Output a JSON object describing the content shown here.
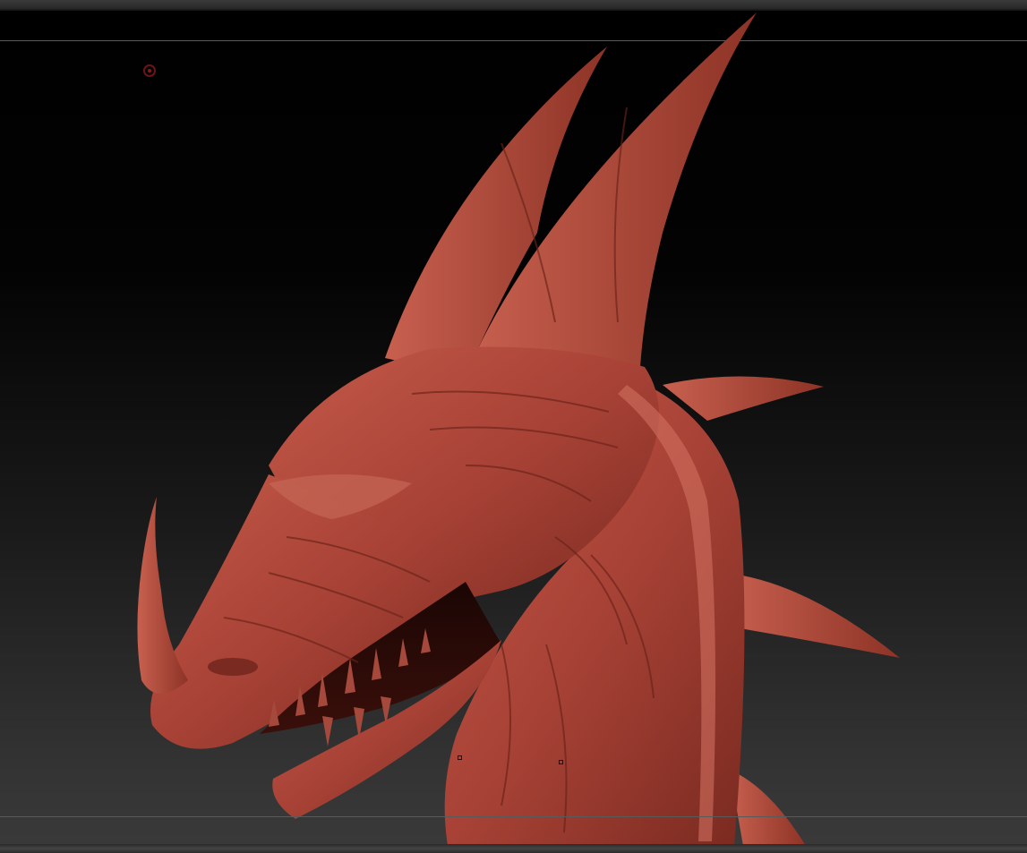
{
  "viewport": {
    "background_top": "#000000",
    "background_bottom": "#3a3a3a",
    "frame_line_color": "#5a5a5a"
  },
  "model": {
    "subject": "dragon-head-sculpt",
    "material_color": "#b0473a",
    "highlight_color": "#cf6a5a",
    "shadow_color": "#5a1a12"
  },
  "brush_cursor": {
    "icon": "brush-circle-icon",
    "color": "#6e1414"
  }
}
